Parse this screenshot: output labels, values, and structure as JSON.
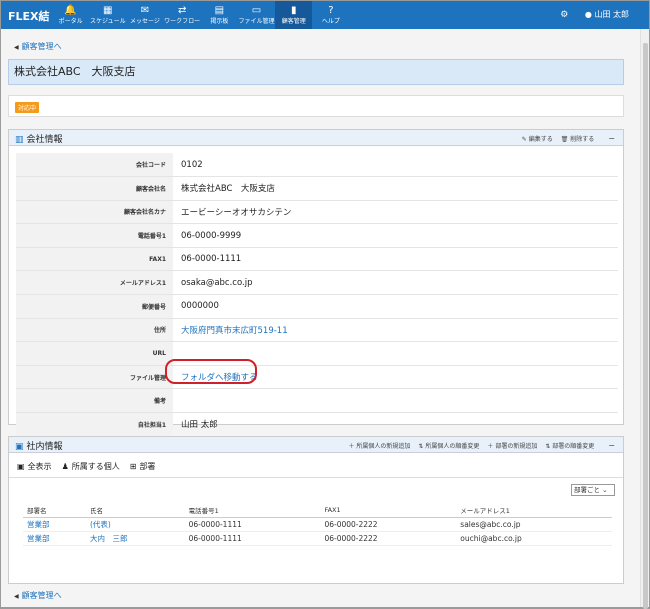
{
  "app": {
    "logo": "FLEX結"
  },
  "nav": [
    {
      "icon": "bell-icon",
      "glyph": "🔔",
      "label": "ポータル"
    },
    {
      "icon": "calendar-icon",
      "glyph": "▦",
      "label": "スケジュール"
    },
    {
      "icon": "mail-icon",
      "glyph": "✉",
      "label": "メッセージ"
    },
    {
      "icon": "workflow-icon",
      "glyph": "⇄",
      "label": "ワークフロー"
    },
    {
      "icon": "board-icon",
      "glyph": "▤",
      "label": "掲示板"
    },
    {
      "icon": "file-icon",
      "glyph": "▭",
      "label": "ファイル管理"
    },
    {
      "icon": "customer-icon",
      "glyph": "▮",
      "label": "顧客管理"
    },
    {
      "icon": "help-icon",
      "glyph": "?",
      "label": "ヘルプ"
    }
  ],
  "user": {
    "name": "山田 太郎"
  },
  "breadcrumb": {
    "back": "顧客管理へ"
  },
  "page": {
    "title": "株式会社ABC　大阪支店",
    "status": "対応中"
  },
  "company_panel": {
    "title": "会社情報",
    "edit": "編集する",
    "delete": "削除する",
    "rows": [
      {
        "key": "会社コード",
        "value": "0102"
      },
      {
        "key": "顧客会社名",
        "value": "株式会社ABC　大阪支店"
      },
      {
        "key": "顧客会社名カナ",
        "value": "エービーシーオオサカシテン"
      },
      {
        "key": "電話番号1",
        "value": "06-0000-9999"
      },
      {
        "key": "FAX1",
        "value": "06-0000-1111"
      },
      {
        "key": "メールアドレス1",
        "value": "osaka@abc.co.jp"
      },
      {
        "key": "郵便番号",
        "value": "0000000"
      },
      {
        "key": "住所",
        "value": "大阪府門真市末広町519-11"
      },
      {
        "key": "URL",
        "value": ""
      },
      {
        "key": "ファイル管理",
        "value": "フォルダへ移動する"
      },
      {
        "key": "備考",
        "value": ""
      },
      {
        "key": "自社担当1",
        "value": "山田 太郎"
      }
    ]
  },
  "internal_panel": {
    "title": "社内情報",
    "actions": [
      "所属個人の新規追加",
      "所属個人の順番変更",
      "部署の新規追加",
      "部署の順番変更"
    ],
    "tabs": [
      "全表示",
      "所属する個人",
      "部署"
    ],
    "sort_select": "部署ごと",
    "columns": [
      "部署名",
      "氏名",
      "電話番号1",
      "FAX1",
      "メールアドレス1"
    ],
    "rows": [
      [
        "営業部",
        "(代表)",
        "06-0000-1111",
        "06-0000-2222",
        "sales@abc.co.jp"
      ],
      [
        "営業部",
        "大内　三郎",
        "06-0000-1111",
        "06-0000-2222",
        "ouchi@abc.co.jp"
      ]
    ]
  },
  "footer": {
    "back": "顧客管理へ"
  }
}
